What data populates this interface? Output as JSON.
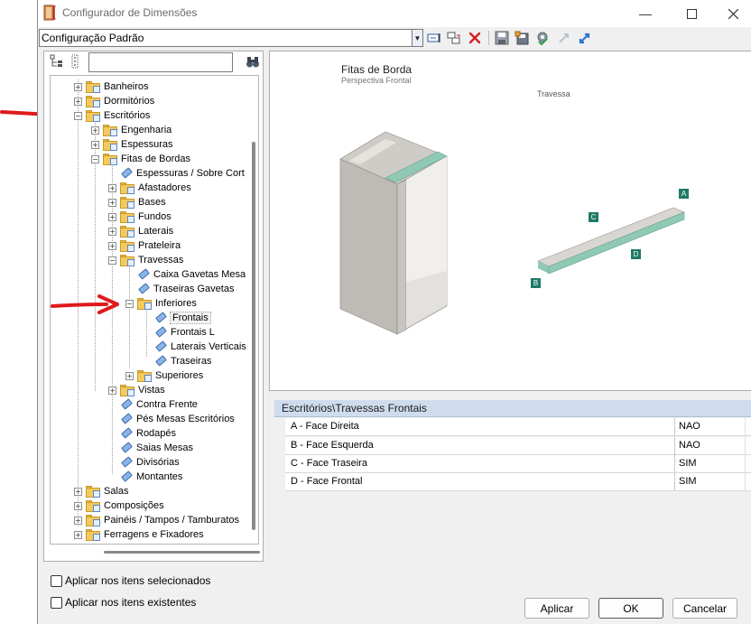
{
  "window": {
    "title": "Configurador de Dimensões",
    "minimize_icon": "minimize-icon",
    "maximize_icon": "maximize-icon",
    "close_icon": "close-icon"
  },
  "toolbar": {
    "config_value": "Configuração Padrão",
    "icons": [
      "rename-icon",
      "copy-config-icon",
      "delete-icon",
      "save-icon",
      "save-as-icon",
      "settings-check-icon",
      "collapse-icon",
      "expand-icon"
    ]
  },
  "tree": {
    "search_value": "",
    "nodes": [
      {
        "label": "Banheiros"
      },
      {
        "label": "Dormitórios"
      },
      {
        "label": "Escritórios"
      },
      {
        "label": "Engenharia"
      },
      {
        "label": "Espessuras"
      },
      {
        "label": "Fitas de Bordas"
      },
      {
        "label": "Espessuras / Sobre Cort"
      },
      {
        "label": "Afastadores"
      },
      {
        "label": "Bases"
      },
      {
        "label": "Fundos"
      },
      {
        "label": "Laterais"
      },
      {
        "label": "Prateleira"
      },
      {
        "label": "Travessas"
      },
      {
        "label": "Caixa Gavetas Mesa"
      },
      {
        "label": "Traseiras Gavetas"
      },
      {
        "label": "Inferiores"
      },
      {
        "label": "Frontais"
      },
      {
        "label": "Frontais L"
      },
      {
        "label": "Laterais Verticais"
      },
      {
        "label": "Traseiras"
      },
      {
        "label": "Superiores"
      },
      {
        "label": "Vistas"
      },
      {
        "label": "Contra Frente"
      },
      {
        "label": "Pés Mesas Escritórios"
      },
      {
        "label": "Rodapés"
      },
      {
        "label": "Saias Mesas"
      },
      {
        "label": "Divisórias"
      },
      {
        "label": "Montantes"
      },
      {
        "label": "Salas"
      },
      {
        "label": "Composições"
      },
      {
        "label": "Painéis / Tampos / Tamburatos"
      },
      {
        "label": "Ferragens e Fixadores"
      }
    ]
  },
  "preview": {
    "title": "Fitas de Borda",
    "subtitle": "Perspectiva Frontal",
    "part_label": "Travessa",
    "face_labels": {
      "a": "A",
      "b": "B",
      "c": "C",
      "d": "D"
    },
    "colors": {
      "face_marker": "#1f7a66",
      "edge_band": "#8fc9b5",
      "panel": "#d9d6d1"
    }
  },
  "props": {
    "title": "Escritórios\\Travessas Frontais",
    "rows": [
      {
        "label": "A - Face Direita",
        "value": "NAO"
      },
      {
        "label": "B - Face Esquerda",
        "value": "NAO"
      },
      {
        "label": "C - Face Traseira",
        "value": "SIM"
      },
      {
        "label": "D - Face Frontal",
        "value": "SIM"
      }
    ]
  },
  "options": {
    "apply_selected": "Aplicar nos itens selecionados",
    "apply_existing": "Aplicar nos itens existentes"
  },
  "buttons": {
    "apply": "Aplicar",
    "ok": "OK",
    "cancel": "Cancelar"
  },
  "annotation": {
    "arrow_color": "#e0191b"
  }
}
